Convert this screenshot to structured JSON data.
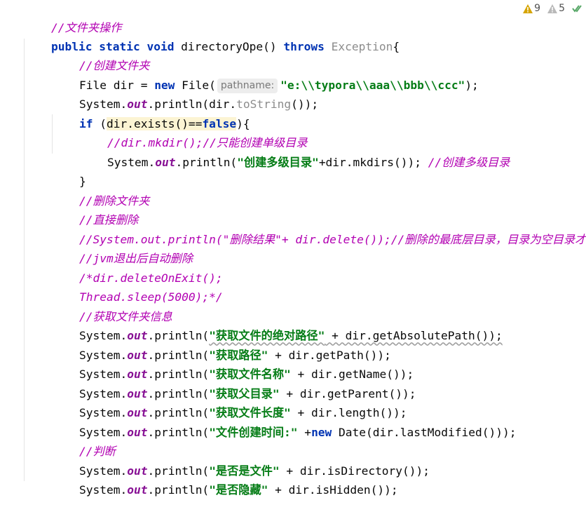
{
  "status": {
    "errors_count": "9",
    "warnings_count": "5",
    "error_color": "#d6a400",
    "warning_color": "#b9b9b9",
    "check_color": "#59a869"
  },
  "code": {
    "l1_comment": "//文件夹操作",
    "l2_public": "public",
    "l2_static": "static",
    "l2_void": "void",
    "l2_name": " directoryOpe() ",
    "l2_throws": "throws",
    "l2_exception": "Exception",
    "l2_brace": "{",
    "l3_comment": "//创建文件夹",
    "l4_a": "File dir = ",
    "l4_new": "new",
    "l4_b": " File(",
    "l4_hint": "pathname:",
    "l4_str": "\"e:\\\\typora\\\\aaa\\\\bbb\\\\ccc\"",
    "l4_end": ");",
    "l5_a": "System.",
    "l5_out": "out",
    "l5_b": ".println(dir.",
    "l5_tostring": "toString",
    "l5_end": "());",
    "l6_if": "if",
    "l6_a": " (",
    "l6_cond": "dir.exists()==",
    "l6_false": "false",
    "l6_end": "){",
    "l7_comment_code": "//dir.mkdir();",
    "l7_comment": "//只能创建单级目录",
    "l8_a": "System.",
    "l8_out": "out",
    "l8_b": ".println(",
    "l8_str": "\"创建多级目录\"",
    "l8_c": "+dir.mkdirs()); ",
    "l8_comment": "//创建多级目录",
    "l9_brace": "}",
    "l10_comment": "//删除文件夹",
    "l11_comment": "//直接删除",
    "l12_comment": "//System.out.println(\"删除结果\"+ dir.delete());//删除的最底层目录，目录为空目录才行",
    "l13_comment": "//jvm退出后自动删除",
    "l14_comment": "/*dir.deleteOnExit();",
    "l15_comment": "Thread.sleep(5000);*/",
    "l16_comment": "//获取文件夹信息",
    "l17_str": "\"获取文件的绝对路径\"",
    "l17_rest": " + dir.getAbsolutePath());",
    "l18_str": "\"获取路径\"",
    "l18_rest": " + dir.getPath());",
    "l19_str": "\"获取文件名称\"",
    "l19_rest": " + dir.getName());",
    "l20_str": "\"获取父目录\"",
    "l20_rest": " + dir.getParent());",
    "l21_str": "\"获取文件长度\"",
    "l21_rest": " + dir.length());",
    "l22_str": "\"文件创建时间:\"",
    "l22_a": " +",
    "l22_new": "new",
    "l22_rest": " Date(dir.lastModified()));",
    "l23_comment": "//判断",
    "l24_str": "\"是否是文件\"",
    "l24_rest": " + dir.isDirectory());",
    "l25_str": "\"是否隐藏\"",
    "l25_rest": " + dir.isHidden());",
    "sys": "System.",
    "out": "out",
    "println": ".println("
  }
}
